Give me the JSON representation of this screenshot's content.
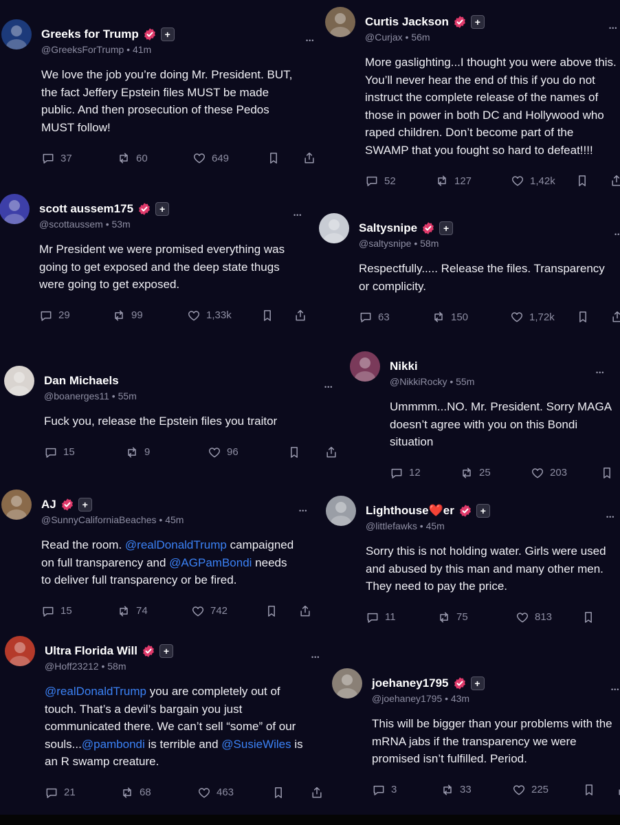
{
  "colors": {
    "background": "#0b0a1c",
    "verified_badge": "#e03a6b",
    "mention": "#3b82f6",
    "muted_text": "#8e8ea3"
  },
  "icons": [
    "reply-icon",
    "repost-icon",
    "like-icon",
    "bookmark-icon",
    "share-icon",
    "more-icon",
    "verified-badge-icon",
    "subscribe-plus-icon"
  ],
  "posts": [
    {
      "name": "Greeks for Trump",
      "handle": "@GreeksForTrump • 41m",
      "text": [
        {
          "t": "We love the job you’re doing Mr. President. BUT,\nthe fact Jeffery Epstein files MUST be made\npublic. And then prosecution of these Pedos\nMUST follow!"
        }
      ],
      "replies": "37",
      "reposts": "60",
      "likes": "649"
    },
    {
      "name": "scott aussem175",
      "handle": "@scottaussem • 53m",
      "text": [
        {
          "t": "Mr President we were promised everything was\ngoing to get exposed and the deep state thugs\nwere going to get exposed."
        }
      ],
      "replies": "29",
      "reposts": "99",
      "likes": "1,33k"
    },
    {
      "name": "Dan Michaels",
      "handle": "@boanerges11 • 55m",
      "text": [
        {
          "t": "Fuck you, release the Epstein files you traitor"
        }
      ],
      "replies": "15",
      "reposts": "9",
      "likes": "96"
    },
    {
      "name": "AJ",
      "handle": "@SunnyCaliforniaBeaches • 45m",
      "text": [
        {
          "t": "Read the room. "
        },
        {
          "t": "@realDonaldTrump",
          "m": true
        },
        {
          "t": " campaigned\non full transparency and "
        },
        {
          "t": "@AGPamBondi",
          "m": true
        },
        {
          "t": " needs\nto deliver full transparency or be fired."
        }
      ],
      "replies": "15",
      "reposts": "74",
      "likes": "742"
    },
    {
      "name": "Ultra Florida Will",
      "handle": "@Hoff23212 • 58m",
      "text": [
        {
          "t": "@realDonaldTrump",
          "m": true
        },
        {
          "t": " you are completely out of\ntouch. That’s a devil’s bargain you just\ncommunicated there. We can’t sell “some” of our\nsouls..."
        },
        {
          "t": "@pambondi",
          "m": true
        },
        {
          "t": " is terrible and "
        },
        {
          "t": "@SusieWiles",
          "m": true
        },
        {
          "t": " is\nan R swamp creature."
        }
      ],
      "replies": "21",
      "reposts": "68",
      "likes": "463"
    },
    {
      "name": "Curtis Jackson",
      "handle": "@Curjax • 56m",
      "text": [
        {
          "t": "More gaslighting...I thought you were above this.\nYou’ll never hear the end of this if you do not\ninstruct the complete release of the names of\nthose in power in both DC and Hollywood who\nraped children. Don’t become part of the\nSWAMP that you fought so hard to defeat!!!!"
        }
      ],
      "replies": "52",
      "reposts": "127",
      "likes": "1,42k"
    },
    {
      "name": "Saltysnipe",
      "handle": "@saltysnipe • 58m",
      "text": [
        {
          "t": "Respectfully..... Release the files. Transparency\nor complicity."
        }
      ],
      "replies": "63",
      "reposts": "150",
      "likes": "1,72k"
    },
    {
      "name": "Nikki",
      "handle": "@NikkiRocky • 55m",
      "text": [
        {
          "t": "Ummmm...NO. Mr. President. Sorry MAGA\ndoesn’t agree with you on this Bondi situation"
        }
      ],
      "replies": "12",
      "reposts": "25",
      "likes": "203"
    },
    {
      "name": "Lighthouse❤️er",
      "handle": "@littlefawks • 45m",
      "text": [
        {
          "t": "Sorry this is not holding water. Girls were used\nand abused by this man and many other men.\nThey need to pay the price."
        }
      ],
      "replies": "11",
      "reposts": "75",
      "likes": "813"
    },
    {
      "name": "joehaney1795",
      "handle": "@joehaney1795 • 43m",
      "text": [
        {
          "t": "This will be bigger than your problems with the\nmRNA jabs if the transparency we were\npromised isn’t fulfilled. Period."
        }
      ],
      "replies": "3",
      "reposts": "33",
      "likes": "225"
    }
  ]
}
